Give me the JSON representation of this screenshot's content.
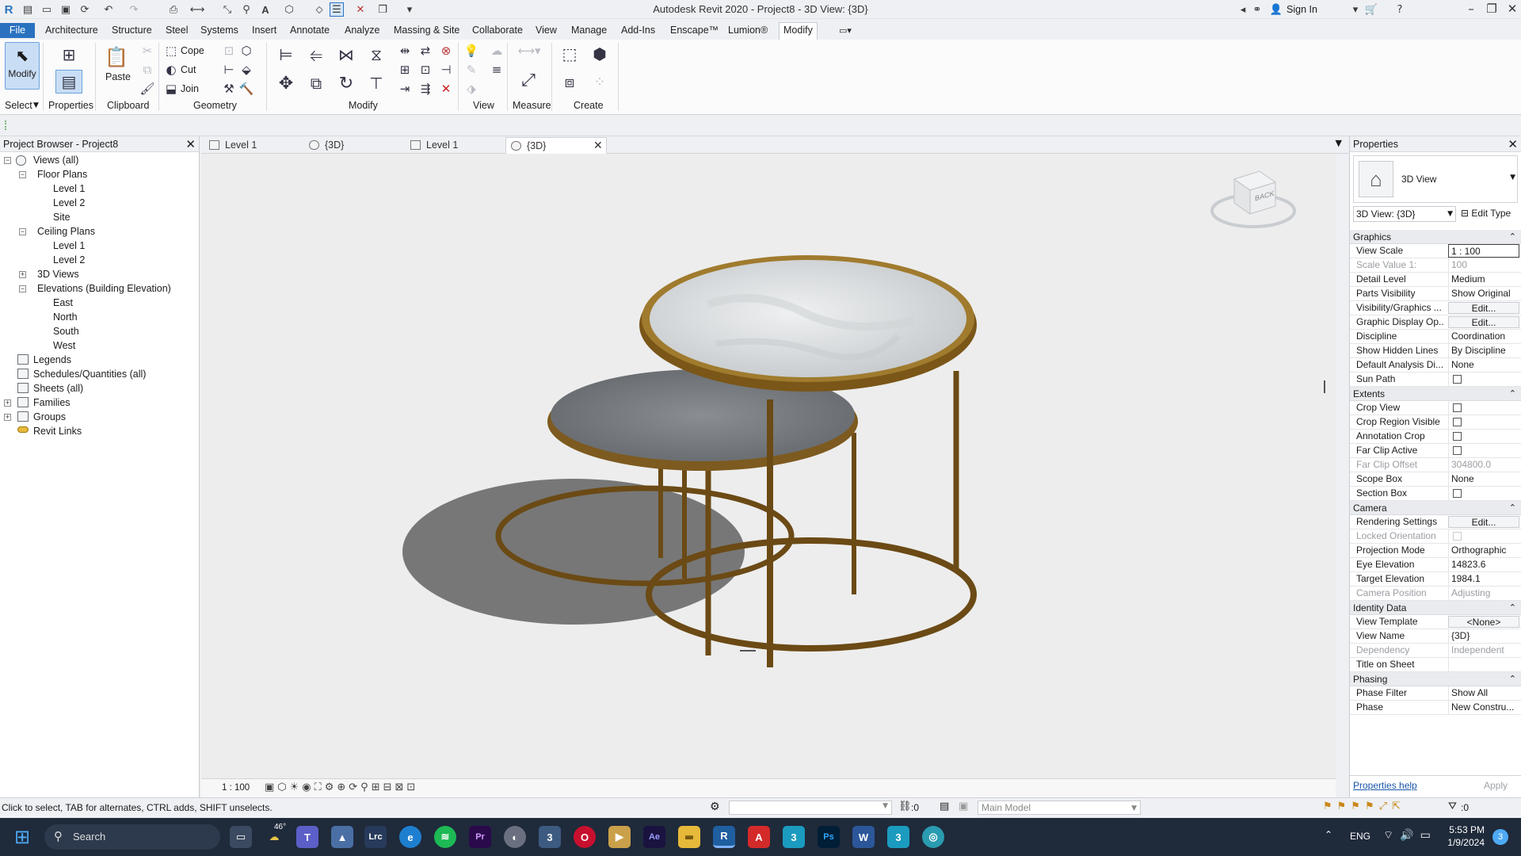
{
  "app": {
    "title": "Autodesk Revit 2020 - Project8 - 3D View: {3D}",
    "sign_in": "Sign In"
  },
  "ribbon": {
    "tabs": [
      "File",
      "Architecture",
      "Structure",
      "Steel",
      "Systems",
      "Insert",
      "Annotate",
      "Analyze",
      "Massing & Site",
      "Collaborate",
      "View",
      "Manage",
      "Add-Ins",
      "Enscape™",
      "Lumion®",
      "Modify"
    ],
    "active_tab": "Modify",
    "modify_label": "Modify",
    "properties_label": "Properties",
    "paste_label": "Paste",
    "cope_label": "Cope",
    "cut_label": "Cut",
    "join_label": "Join",
    "panels": {
      "select": "Select",
      "properties": "Properties",
      "clipboard": "Clipboard",
      "geometry": "Geometry",
      "modify": "Modify",
      "view": "View",
      "measure": "Measure",
      "create": "Create"
    }
  },
  "browser": {
    "title": "Project Browser - Project8",
    "items": {
      "views_all": "Views (all)",
      "floor_plans": "Floor Plans",
      "fp_level1": "Level 1",
      "fp_level2": "Level 2",
      "fp_site": "Site",
      "ceiling_plans": "Ceiling Plans",
      "cp_level1": "Level 1",
      "cp_level2": "Level 2",
      "views_3d": "3D Views",
      "elevations": "Elevations (Building Elevation)",
      "el_east": "East",
      "el_north": "North",
      "el_south": "South",
      "el_west": "West",
      "legends": "Legends",
      "schedules": "Schedules/Quantities (all)",
      "sheets": "Sheets (all)",
      "families": "Families",
      "groups": "Groups",
      "revit_links": "Revit Links"
    }
  },
  "view_tabs": [
    "Level 1",
    "{3D}",
    "Level 1",
    "{3D}"
  ],
  "viewcube_label": "BACK",
  "view_scale_text": "1 : 100",
  "properties": {
    "title": "Properties",
    "type_name": "3D View",
    "instance_selector": "3D View: {3D}",
    "edit_type": "Edit Type",
    "categories": {
      "graphics": "Graphics",
      "extents": "Extents",
      "camera": "Camera",
      "identity": "Identity Data",
      "phasing": "Phasing"
    },
    "rows": {
      "view_scale": {
        "name": "View Scale",
        "value": "1 : 100"
      },
      "scale_value": {
        "name": "Scale Value    1:",
        "value": "100"
      },
      "detail_level": {
        "name": "Detail Level",
        "value": "Medium"
      },
      "parts_visibility": {
        "name": "Parts Visibility",
        "value": "Show Original"
      },
      "vis_graphics": {
        "name": "Visibility/Graphics ...",
        "value": "Edit..."
      },
      "graphic_display": {
        "name": "Graphic Display Op...",
        "value": "Edit..."
      },
      "discipline": {
        "name": "Discipline",
        "value": "Coordination"
      },
      "hidden_lines": {
        "name": "Show Hidden Lines",
        "value": "By Discipline"
      },
      "default_analysis": {
        "name": "Default Analysis Di...",
        "value": "None"
      },
      "sun_path": {
        "name": "Sun Path",
        "value": ""
      },
      "crop_view": {
        "name": "Crop View",
        "value": ""
      },
      "crop_region": {
        "name": "Crop Region Visible",
        "value": ""
      },
      "annotation_crop": {
        "name": "Annotation Crop",
        "value": ""
      },
      "far_clip_active": {
        "name": "Far Clip Active",
        "value": ""
      },
      "far_clip_offset": {
        "name": "Far Clip Offset",
        "value": "304800.0"
      },
      "scope_box": {
        "name": "Scope Box",
        "value": "None"
      },
      "section_box": {
        "name": "Section Box",
        "value": ""
      },
      "rendering": {
        "name": "Rendering Settings",
        "value": "Edit..."
      },
      "locked_orientation": {
        "name": "Locked Orientation",
        "value": ""
      },
      "projection_mode": {
        "name": "Projection Mode",
        "value": "Orthographic"
      },
      "eye_elevation": {
        "name": "Eye Elevation",
        "value": "14823.6"
      },
      "target_elevation": {
        "name": "Target Elevation",
        "value": "1984.1"
      },
      "camera_position": {
        "name": "Camera Position",
        "value": "Adjusting"
      },
      "view_template": {
        "name": "View Template",
        "value": "<None>"
      },
      "view_name": {
        "name": "View Name",
        "value": "{3D}"
      },
      "dependency": {
        "name": "Dependency",
        "value": "Independent"
      },
      "title_on_sheet": {
        "name": "Title on Sheet",
        "value": ""
      },
      "phase_filter": {
        "name": "Phase Filter",
        "value": "Show All"
      },
      "phase": {
        "name": "Phase",
        "value": "New Constru..."
      }
    },
    "help_link": "Properties help",
    "apply": "Apply"
  },
  "status": {
    "message": "Click to select, TAB for alternates, CTRL adds, SHIFT unselects.",
    "worksets": ":0",
    "model": "Main Model",
    "filter": ":0"
  },
  "taskbar": {
    "search": "Search",
    "weather": "46°",
    "lang": "ENG",
    "time": "5:53 PM",
    "date": "1/9/2024",
    "notifications": "3"
  },
  "colors": {
    "accent": "#2a72c0",
    "wood": "#6b4a15",
    "taskbar": "#1f2a3b"
  }
}
